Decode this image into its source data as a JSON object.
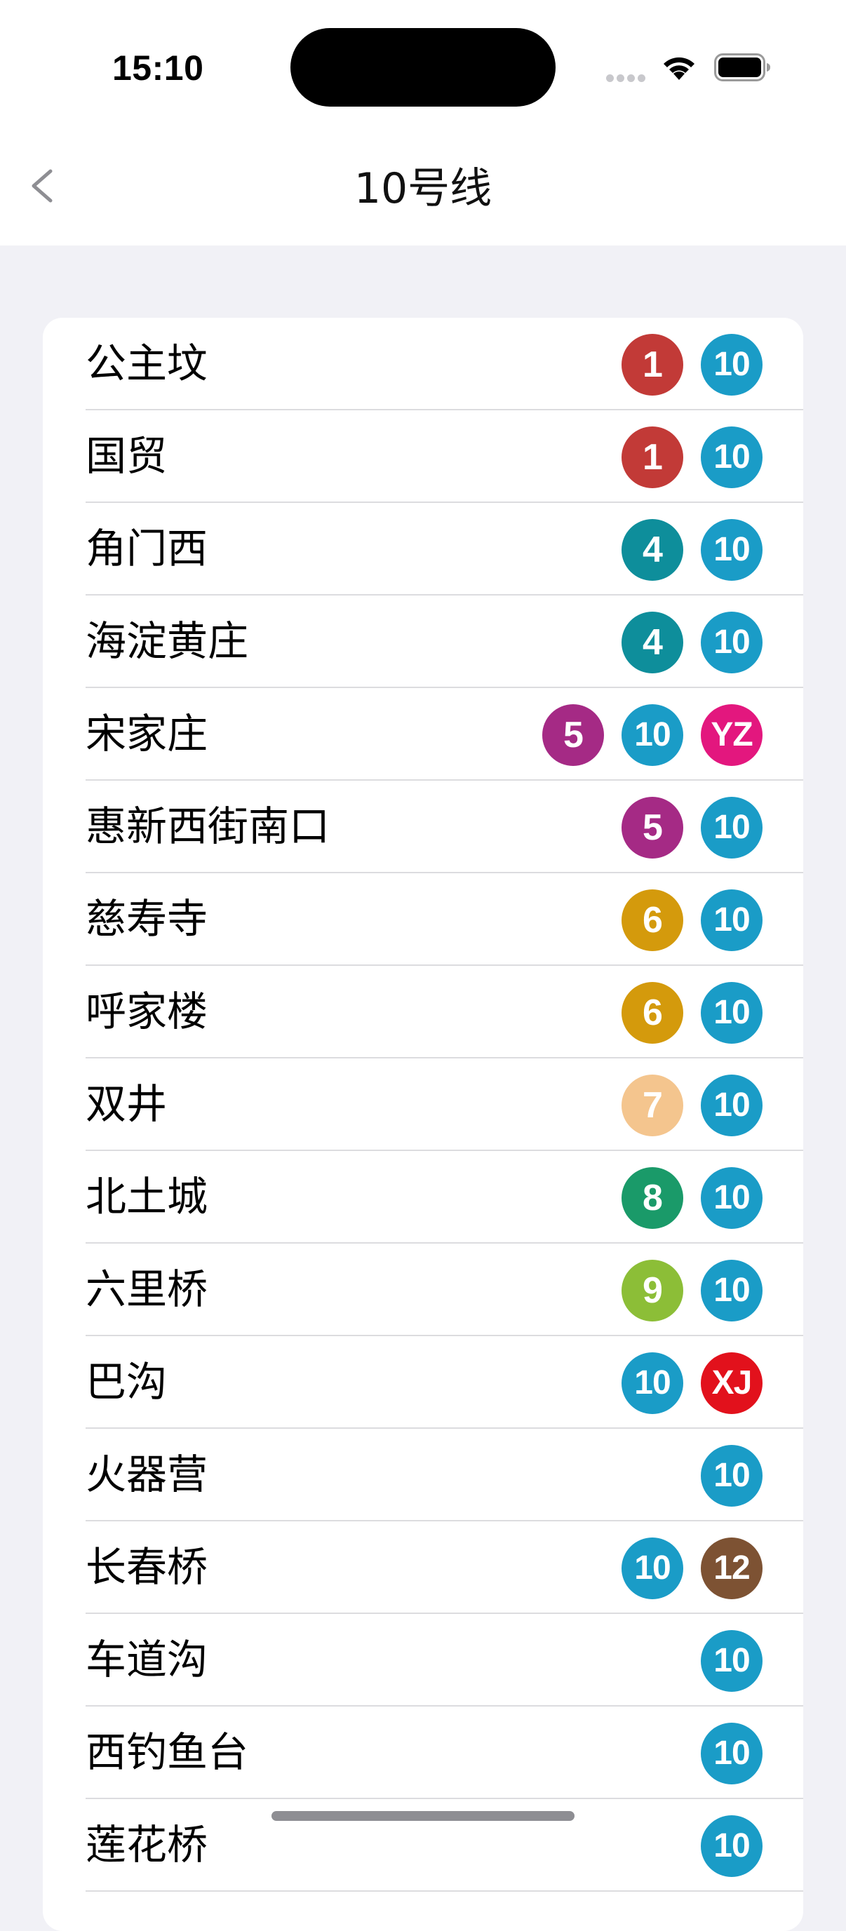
{
  "status_bar": {
    "time": "15:10"
  },
  "nav": {
    "title": "10号线"
  },
  "colors": {
    "1": "#c23a37",
    "4": "#0e8e9b",
    "5": "#a52a85",
    "6": "#d49a0c",
    "7": "#f4c58e",
    "8": "#1a9a69",
    "9": "#8cbe37",
    "10": "#1a9cc7",
    "12": "#7d5233",
    "YZ": "#e3177e",
    "XJ": "#e2111c"
  },
  "stations": [
    {
      "name": "公主坟",
      "lines": [
        "1",
        "10"
      ]
    },
    {
      "name": "国贸",
      "lines": [
        "1",
        "10"
      ]
    },
    {
      "name": "角门西",
      "lines": [
        "4",
        "10"
      ]
    },
    {
      "name": "海淀黄庄",
      "lines": [
        "4",
        "10"
      ]
    },
    {
      "name": "宋家庄",
      "lines": [
        "5",
        "10",
        "YZ"
      ]
    },
    {
      "name": "惠新西街南口",
      "lines": [
        "5",
        "10"
      ]
    },
    {
      "name": "慈寿寺",
      "lines": [
        "6",
        "10"
      ]
    },
    {
      "name": "呼家楼",
      "lines": [
        "6",
        "10"
      ]
    },
    {
      "name": "双井",
      "lines": [
        "7",
        "10"
      ]
    },
    {
      "name": "北土城",
      "lines": [
        "8",
        "10"
      ]
    },
    {
      "name": "六里桥",
      "lines": [
        "9",
        "10"
      ]
    },
    {
      "name": "巴沟",
      "lines": [
        "10",
        "XJ"
      ]
    },
    {
      "name": "火器营",
      "lines": [
        "10"
      ]
    },
    {
      "name": "长春桥",
      "lines": [
        "10",
        "12"
      ]
    },
    {
      "name": "车道沟",
      "lines": [
        "10"
      ]
    },
    {
      "name": "西钓鱼台",
      "lines": [
        "10"
      ]
    },
    {
      "name": "莲花桥",
      "lines": [
        "10"
      ]
    }
  ]
}
